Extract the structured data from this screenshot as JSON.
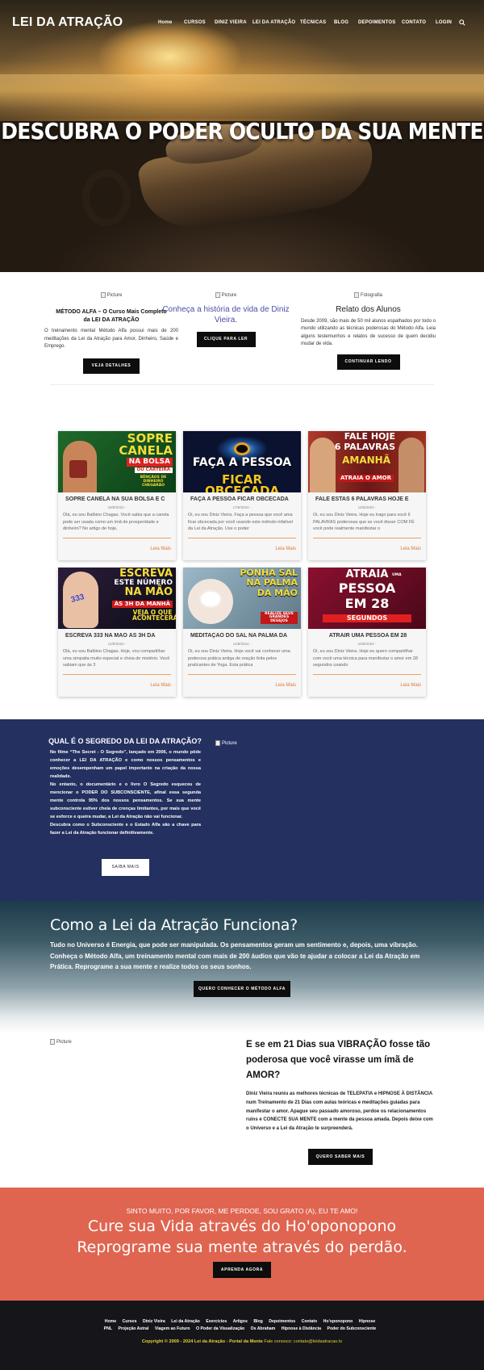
{
  "header": {
    "brand": "LEI DA ATRAÇÃO",
    "nav": [
      "Home",
      "CURSOS",
      "DINIZ VIEIRA",
      "LEI DA ATRAÇÃO",
      "TÉCNICAS",
      "BLOG",
      "DEPOIMENTOS",
      "CONTATO",
      "LOGIN"
    ],
    "search_icon": "search-icon"
  },
  "hero": {
    "title": "DESCUBRA O PODER OCULTO DA SUA MENTE"
  },
  "features": [
    {
      "img_alt": "Picture",
      "title": "MÉTODO ALFA – O Curso Mais Completo da LEI DA ATRAÇÃO",
      "text": "O treinamento mental Método Alfa possui mais de 200 meditações da Lei da Atração para Amor, Dinheiro, Saúde e Emprego.",
      "button": "VEJA DETALHES"
    },
    {
      "img_alt": "Picture",
      "title": "Conheça a história de vida de Diniz Vieira.",
      "text": "",
      "button": "CLIQUE PARA LER"
    },
    {
      "img_alt": "Fotografia",
      "title": "Relato dos Alunos",
      "text": "Desde 2009, são mais de 50 mil alunos espalhados por todo o mundo utilizando as técnicas poderosas do Método Alfa. Leia alguns testemunhos e relatos de sucesso de quem decidiu mudar de vida.",
      "button": "CONTINUAR LENDO"
    }
  ],
  "posts": [
    {
      "thumb": [
        "SOPRE",
        "CANELA",
        "NA BOLSA",
        "OU CARTEIRA",
        "BÊNÇÃOS DE DINHEIRO CHEGARÃO"
      ],
      "title": "SOPRE CANELA NA SUA BOLSA E C",
      "date": "18/8/2024 -",
      "excerpt": "Olá, eu sou Balbino Chagas. Você sabia que a canela pode ser usada como um ímã de prosperidade e dinheiro? No artigo de hoje,",
      "more": "Leia Mais"
    },
    {
      "thumb": [
        "FAÇA A PESSOA",
        "FICAR OBCECADA"
      ],
      "title": "FAÇA A PESSOA FICAR OBCECADA",
      "date": "17/8/2024 -",
      "excerpt": "Oi, eu sou Diniz Vieira. Faça a pessoa que você ama ficar obcecada por você usando este método infalível da Lei da Atração. Use o poder",
      "more": "Leia Mais"
    },
    {
      "thumb": [
        "FALE HOJE",
        "6 PALAVRAS",
        "AMANHÃ",
        "ATRAIA O AMOR"
      ],
      "title": "FALE ESTAS 6 PALAVRAS HOJE E",
      "date": "14/8/2024 -",
      "excerpt": "Oi, eu sou Diniz Vieira. Hoje eu trago para você 6 PALAVRAS poderosas que se você disser COM FÉ você pode realmente manifestar o",
      "more": "Leia Mais"
    },
    {
      "thumb": [
        "ESCREVA",
        "ESTE NÚMERO",
        "NA MÃO",
        "ÀS 3H DA MANHÃ",
        "VEJA O QUE ACONTECERÁ"
      ],
      "title": "ESCREVA 333 NA MÃO ÀS 3H DA",
      "date": "12/8/2024 -",
      "excerpt": "Olá, eu sou Balbino Chagas. Hoje, vou compartilhar uma simpatia muito especial e cheia de mistério. Você sabiam que às 3",
      "more": "Leia Mais"
    },
    {
      "thumb": [
        "PONHA SAL",
        "NA PALMA",
        "DA MÃO",
        "REALIZE SEUS GRANDES DESEJOS"
      ],
      "title": "MEDITAÇÃO DO SAL NA PALMA DA",
      "date": "11/8/2024 -",
      "excerpt": "Oi, eu sou Diniz Vieira. Hoje você vai conhecer uma poderosa prática antiga de oração feita pelos praticantes de Yoga. Esta prática",
      "more": "Leia Mais"
    },
    {
      "thumb": [
        "ATRAIA",
        "UMA",
        "PESSOA",
        "EM 28",
        "SEGUNDOS"
      ],
      "title": "ATRAIR UMA PESSOA EM 28",
      "date": "10/8/2024 -",
      "excerpt": "Oi, eu sou Diniz Vieira. Hoje eu quero compartilhar com você uma técnica para manifestar o amor em 28 segundos usando",
      "more": "Leia Mais"
    }
  ],
  "secret": {
    "title": "QUAL É O SEGREDO DA LEI DA ATRAÇÃO?",
    "body": [
      "No filme “The Secret - O Segredo”, lançado em 2006, o mundo pôde conhecer a LEI DA ATRAÇÃO e como nossos pensamentos e emoções desempenham um papel importante na criação da nossa realidade.",
      "No entanto, o documentário e o livro O Segredo esqueceu de mencionar o PODER DO SUBCONSCIENTE, afinal essa segunda mente controla 95% dos nossos pensamentos. Se sua mente subconsciente estiver cheia de crenças limitantes, por mais que você se esforce e queira mudar, a Lei da Atração não vai funcionar.",
      "Descubra como o Subconsciente e o Estado Alfa são a chave para fazer a Lei da Atração funcionar definitivamente."
    ],
    "img_alt": "Picture",
    "button": "SAIBA MAIS"
  },
  "how": {
    "title": "Como a Lei da Atração Funciona?",
    "text": "Tudo no Universo é Energia, que pode ser manipulada. Os pensamentos geram um sentimento e, depois, uma vibração. Conheça o Método Alfa, um treinamento mental com mais de 200 áudios que vão te ajudar a colocar a Lei da Atração em Prática. Reprograme a sua mente e realize todos os seus sonhos.",
    "button": "QUERO CONHECER O MÉTODO ALFA"
  },
  "days": {
    "img_alt": "Picture",
    "title": "E se em 21 Dias sua VIBRAÇÃO fosse tão poderosa que você virasse um ímã de AMOR?",
    "text": "Diniz Vieira reuniu as melhores técnicas de TELEPATIA e HIPNOSE À DISTÂNCIA num Treinamento de 21 Dias com aulas teóricas e meditações guiadas para manifestar o amor. Apague seu passado amoroso, perdoe os relacionamentos ruins e CONECTE SUA MENTE com a mente da pessoa amada. Depois deixe com o Universo e a Lei da Atração te surpreenderá.",
    "button": "QUERO SABER MAIS"
  },
  "hoop": {
    "small": "SINTO MUITO, POR FAVOR, ME PERDOE, SOU GRATO (A), EU TE AMO!",
    "line1": "Cure sua Vida através do Ho'oponopono",
    "line2": "Reprograme sua mente através do perdão.",
    "button": "APRENDA AGORA"
  },
  "footer": {
    "links": [
      "Home",
      "Cursos",
      "Diniz Vieira",
      "Lei da Atração",
      "Exercícios",
      "Artigos",
      "Blog",
      "Depoimentos",
      "Contato",
      "Ho'oponopono",
      "Hipnose",
      "PNL",
      "Projeção Astral",
      "Viagem ao Futuro",
      "O Poder da Visualização",
      "Os Abraham",
      "Hipnose à Distância",
      "Poder do Subconsciente"
    ],
    "copyright": "Copyright © 2009 - 2024 Lei da Atração - Portal da Mente",
    "contact": "Fale conosco: contato@leidaatracao.tv"
  },
  "colors": {
    "navy": "#243060",
    "coral": "#df6550",
    "link_orange": "#e0783a",
    "footer_bg": "#16161a",
    "footer_yellow": "#e6d23a"
  }
}
